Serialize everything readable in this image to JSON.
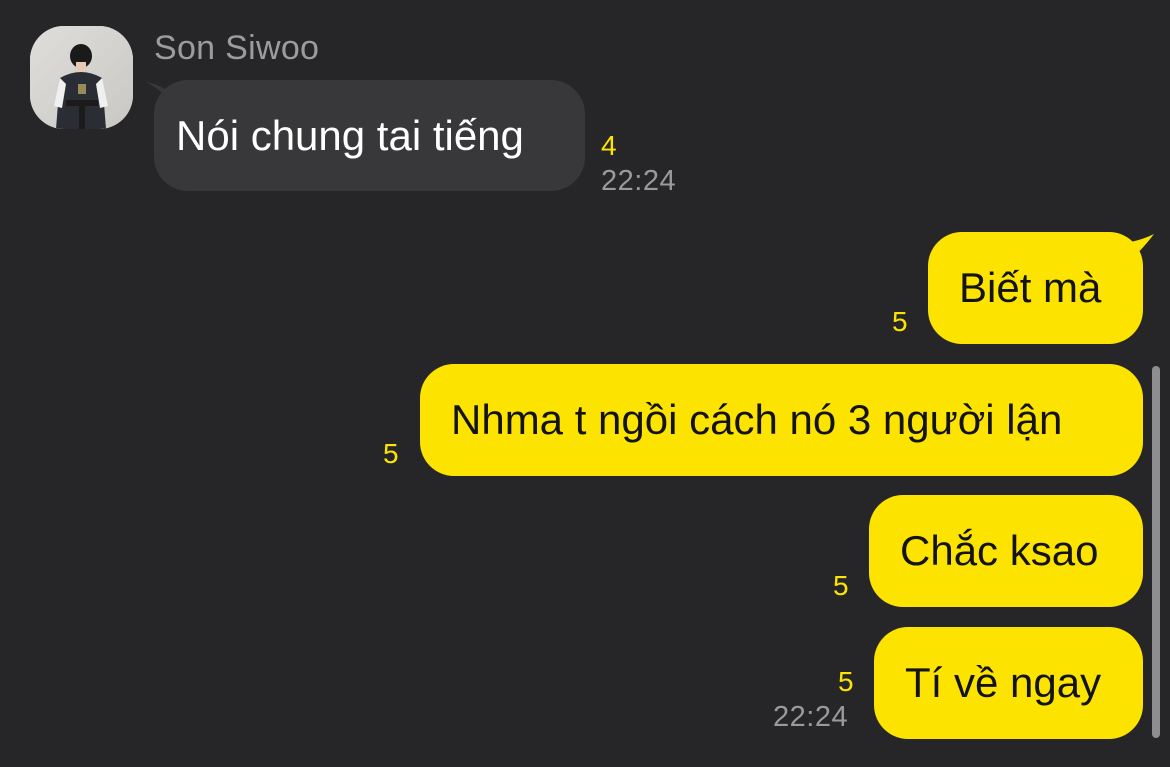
{
  "conversation": {
    "incoming": {
      "sender_name": "Son Siwoo",
      "avatar_icon": "profile-photo",
      "messages": [
        {
          "text": "Nói chung tai tiếng",
          "unread_count": "4",
          "time": "22:24"
        }
      ]
    },
    "outgoing": {
      "messages": [
        {
          "text": "Biết mà",
          "unread_count": "5"
        },
        {
          "text": "Nhma t ngồi cách nó 3 người lận",
          "unread_count": "5"
        },
        {
          "text": "Chắc ksao",
          "unread_count": "5"
        },
        {
          "text": "Tí về ngay",
          "unread_count": "5",
          "time": "22:24"
        }
      ]
    }
  },
  "colors": {
    "background": "#262628",
    "incoming_bubble": "#38383a",
    "outgoing_bubble": "#fde400",
    "unread_accent": "#fde400",
    "timestamp": "#9a9a9c"
  }
}
